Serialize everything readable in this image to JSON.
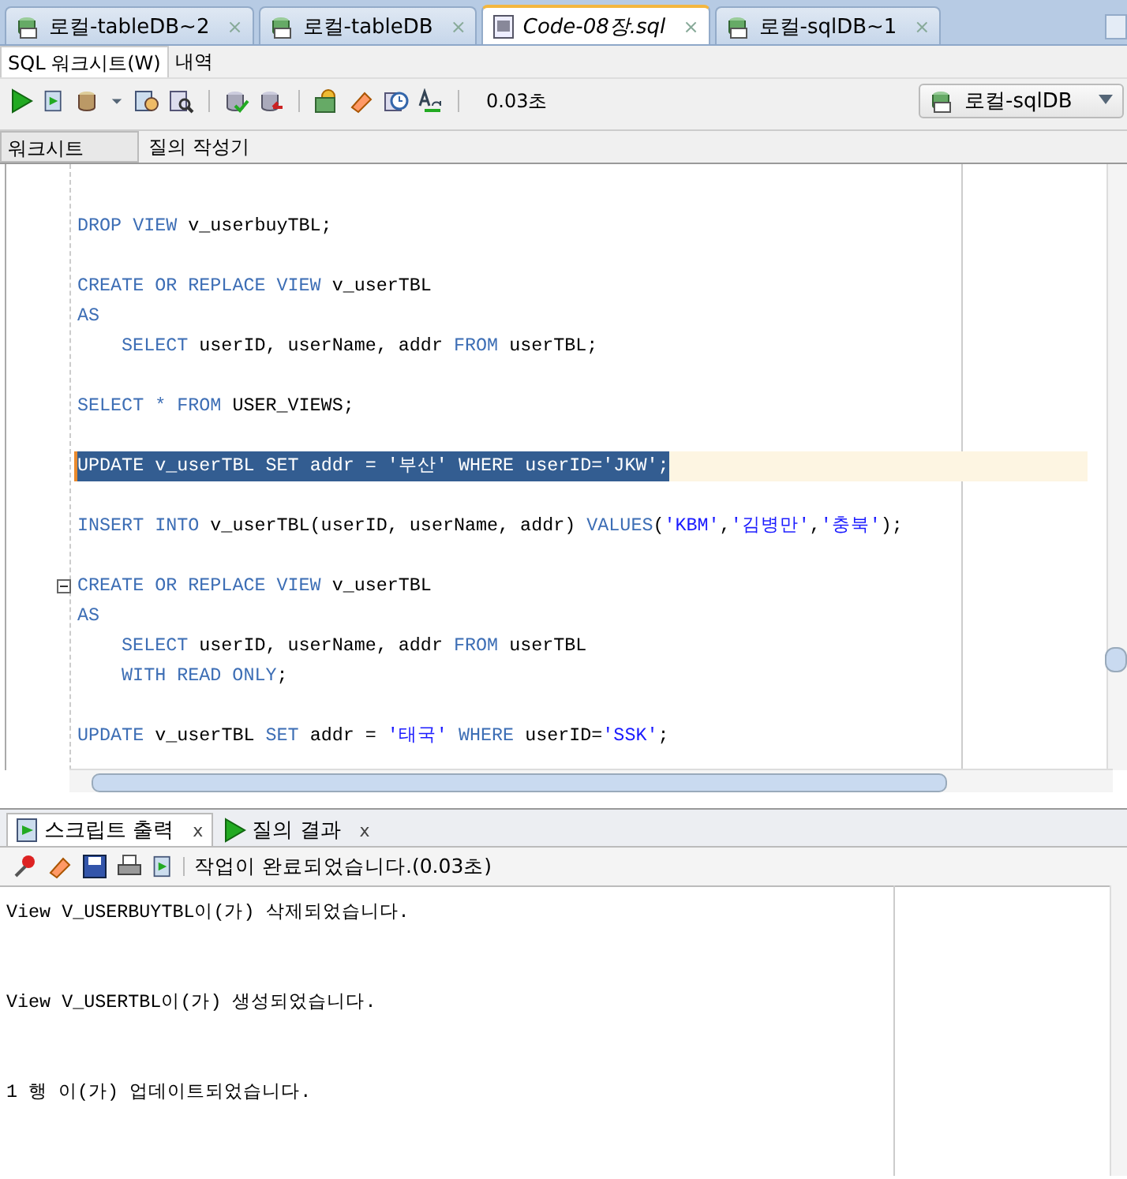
{
  "document_tabs": [
    {
      "label": "로컬-tableDB~2",
      "kind": "connection",
      "selected": false,
      "close": "×"
    },
    {
      "label": "로컬-tableDB",
      "kind": "connection",
      "selected": false,
      "close": "×"
    },
    {
      "label": "Code-08장.sql",
      "kind": "file",
      "selected": true,
      "close": "×"
    },
    {
      "label": "로컬-sqlDB~1",
      "kind": "connection",
      "selected": false,
      "close": "×"
    }
  ],
  "sub_tabs": [
    {
      "label": "SQL 워크시트(W)",
      "selected": true
    },
    {
      "label": "내역",
      "selected": false
    }
  ],
  "toolbar": {
    "elapsed": "0.03초",
    "connection": "로컬-sqlDB"
  },
  "editor_tabs": [
    {
      "label": "워크시트",
      "selected": true
    },
    {
      "label": "질의 작성기",
      "selected": false
    }
  ],
  "code_lines": [
    {
      "kind": "blank"
    },
    {
      "kind": "code",
      "selected": false,
      "indented": false,
      "tokens": [
        {
          "kind": "keyword",
          "text": "DROP VIEW "
        },
        {
          "kind": "plain",
          "text": "v_userbuyTBL;"
        }
      ]
    },
    {
      "kind": "blank"
    },
    {
      "kind": "code",
      "selected": false,
      "indented": false,
      "tokens": [
        {
          "kind": "keyword",
          "text": "CREATE OR REPLACE VIEW "
        },
        {
          "kind": "plain",
          "text": "v_userTBL"
        }
      ]
    },
    {
      "kind": "code",
      "selected": false,
      "indented": false,
      "tokens": [
        {
          "kind": "keyword",
          "text": "AS"
        }
      ]
    },
    {
      "kind": "code",
      "selected": false,
      "indented": true,
      "tokens": [
        {
          "kind": "keyword",
          "text": "SELECT "
        },
        {
          "kind": "plain",
          "text": "userID, userName, addr "
        },
        {
          "kind": "keyword",
          "text": "FROM "
        },
        {
          "kind": "plain",
          "text": "userTBL;"
        }
      ]
    },
    {
      "kind": "blank"
    },
    {
      "kind": "code",
      "selected": false,
      "indented": false,
      "tokens": [
        {
          "kind": "keyword",
          "text": "SELECT * FROM "
        },
        {
          "kind": "plain",
          "text": "USER_VIEWS;"
        }
      ]
    },
    {
      "kind": "blank"
    },
    {
      "kind": "code",
      "selected": true,
      "indented": false,
      "tokens": [
        {
          "kind": "keyword",
          "text": "UPDATE "
        },
        {
          "kind": "plain",
          "text": "v_userTBL "
        },
        {
          "kind": "keyword",
          "text": "SET "
        },
        {
          "kind": "plain",
          "text": "addr = "
        },
        {
          "kind": "string",
          "text": "'부산'"
        },
        {
          "kind": "keyword",
          "text": " WHERE "
        },
        {
          "kind": "plain",
          "text": "userID="
        },
        {
          "kind": "string",
          "text": "'JKW'"
        },
        {
          "kind": "plain",
          "text": ";"
        }
      ]
    },
    {
      "kind": "blank"
    },
    {
      "kind": "code",
      "selected": false,
      "indented": false,
      "tokens": [
        {
          "kind": "keyword",
          "text": "INSERT INTO "
        },
        {
          "kind": "plain",
          "text": "v_userTBL(userID, userName, addr) "
        },
        {
          "kind": "keyword",
          "text": "VALUES"
        },
        {
          "kind": "plain",
          "text": "("
        },
        {
          "kind": "string",
          "text": "'KBM'"
        },
        {
          "kind": "plain",
          "text": ","
        },
        {
          "kind": "string",
          "text": "'김병만'"
        },
        {
          "kind": "plain",
          "text": ","
        },
        {
          "kind": "string",
          "text": "'충북'"
        },
        {
          "kind": "plain",
          "text": ");"
        }
      ]
    },
    {
      "kind": "blank"
    },
    {
      "kind": "code",
      "selected": false,
      "indented": false,
      "foldable": true,
      "tokens": [
        {
          "kind": "keyword",
          "text": "CREATE OR REPLACE VIEW "
        },
        {
          "kind": "plain",
          "text": "v_userTBL"
        }
      ]
    },
    {
      "kind": "code",
      "selected": false,
      "indented": false,
      "tokens": [
        {
          "kind": "keyword",
          "text": "AS"
        }
      ]
    },
    {
      "kind": "code",
      "selected": false,
      "indented": true,
      "tokens": [
        {
          "kind": "keyword",
          "text": "SELECT "
        },
        {
          "kind": "plain",
          "text": "userID, userName, addr "
        },
        {
          "kind": "keyword",
          "text": "FROM "
        },
        {
          "kind": "plain",
          "text": "userTBL"
        }
      ]
    },
    {
      "kind": "code",
      "selected": false,
      "indented": true,
      "tokens": [
        {
          "kind": "keyword",
          "text": "WITH READ ONLY"
        },
        {
          "kind": "plain",
          "text": ";"
        }
      ]
    },
    {
      "kind": "blank"
    },
    {
      "kind": "code",
      "selected": false,
      "indented": false,
      "tokens": [
        {
          "kind": "keyword",
          "text": "UPDATE "
        },
        {
          "kind": "plain",
          "text": "v_userTBL "
        },
        {
          "kind": "keyword",
          "text": "SET "
        },
        {
          "kind": "plain",
          "text": "addr = "
        },
        {
          "kind": "string",
          "text": "'태국'"
        },
        {
          "kind": "keyword",
          "text": " WHERE "
        },
        {
          "kind": "plain",
          "text": "userID="
        },
        {
          "kind": "string",
          "text": "'SSK'"
        },
        {
          "kind": "plain",
          "text": ";"
        }
      ]
    }
  ],
  "output_tabs": [
    {
      "label": "스크립트 출력",
      "kind": "script",
      "selected": true,
      "close": "x"
    },
    {
      "label": "질의 결과",
      "kind": "query",
      "selected": false,
      "close": "x"
    }
  ],
  "output_status": "작업이 완료되었습니다.(0.03초)",
  "output_lines": [
    "View V_USERBUYTBL이(가) 삭제되었습니다.",
    "View V_USERTBL이(가) 생성되었습니다.",
    "1 행 이(가) 업데이트되었습니다."
  ]
}
